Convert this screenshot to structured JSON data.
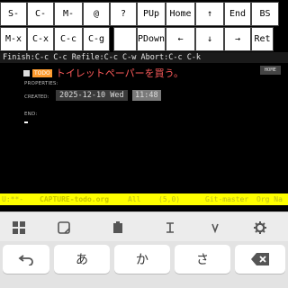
{
  "keys_row1": [
    "S-",
    "C-",
    "M-",
    "@",
    "?",
    "PUp",
    "Home",
    "↑",
    "End",
    "BS"
  ],
  "keys_row2": [
    "M-x",
    "C-x",
    "C-c",
    "C-g",
    "",
    "PDown",
    "←",
    "↓",
    "→",
    "Ret"
  ],
  "minibuffer": "Finish:C-c C-c Refile:C-c C-w Abort:C-c C-k",
  "entry": {
    "todo": "TODO",
    "headline": "トイレットペーパーを買う。",
    "tag": "HOME",
    "properties": "PROPERTIES:",
    "created_label": "CREATED:",
    "created_date": "2025-12-10 Wed",
    "created_time": "11:48",
    "end": "END:"
  },
  "modeline": {
    "status": "U:**-",
    "buffer": "CAPTURE-todo.org",
    "scope": "All",
    "position": "(5,0)",
    "branch": "Git-master",
    "mode": "Org Na"
  },
  "keyboard": {
    "keys": [
      "あ",
      "か",
      "さ"
    ],
    "icons": [
      "grid-icon",
      "sticker-icon",
      "clipboard-icon",
      "text-cursor-icon",
      "settings-icon",
      "undo-icon",
      "backspace-icon"
    ]
  }
}
